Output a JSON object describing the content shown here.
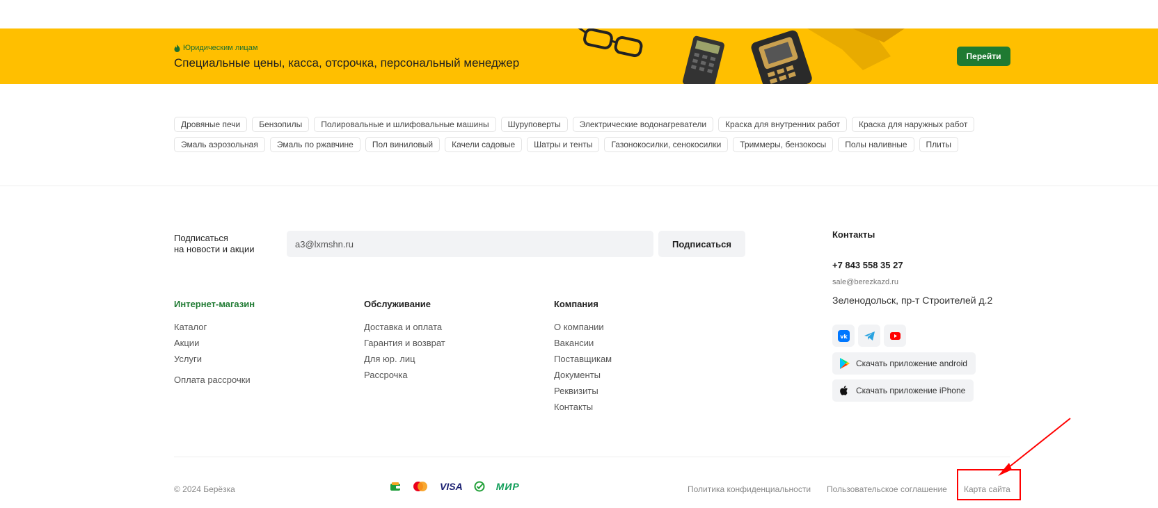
{
  "banner": {
    "kicker": "Юридическим лицам",
    "title": "Специальные цены, касса, отсрочка, персональный менеджер",
    "button": "Перейти"
  },
  "tags": {
    "row1": [
      "Дровяные печи",
      "Бензопилы",
      "Полировальные и шлифовальные машины",
      "Шуруповерты",
      "Электрические водонагреватели",
      "Краска для внутренних работ",
      "Краска для наружных работ"
    ],
    "row2": [
      "Эмаль аэрозольная",
      "Эмаль по ржавчине",
      "Пол виниловый",
      "Качели садовые",
      "Шатры и тенты",
      "Газонокосилки, сенокосилки",
      "Триммеры, бензокосы",
      "Полы наливные",
      "Плиты"
    ]
  },
  "subscribe": {
    "label_line1": "Подписаться",
    "label_line2": "на новости и акции",
    "input_value": "a3@lxmshn.ru",
    "button": "Подписаться"
  },
  "columns": {
    "shop": {
      "title": "Интернет-магазин",
      "links": [
        "Каталог",
        "Акции",
        "Услуги",
        "Оплата рассрочки"
      ]
    },
    "service": {
      "title": "Обслуживание",
      "links": [
        "Доставка и оплата",
        "Гарантия и возврат",
        "Для юр. лиц",
        "Рассрочка"
      ]
    },
    "company": {
      "title": "Компания",
      "links": [
        "О компании",
        "Вакансии",
        "Поставщикам",
        "Документы",
        "Реквизиты",
        "Контакты"
      ]
    }
  },
  "contacts": {
    "title": "Контакты",
    "phone": "+7 843 558 35 27",
    "email": "sale@berezkazd.ru",
    "address": "Зеленодольск, пр-т Строителей д.2",
    "socials": [
      "vk-icon",
      "telegram-icon",
      "youtube-icon"
    ],
    "android": "Скачать приложение android",
    "iphone": "Скачать приложение iPhone"
  },
  "bottom": {
    "copyright": "© 2024 Берёзка",
    "payments": [
      "wallet-icon",
      "mastercard-icon",
      "visa-icon",
      "sber-icon",
      "mir-icon"
    ],
    "visa_text": "VISA",
    "mir_text": "МИР",
    "privacy": "Политика конфиденциальности",
    "agreement": "Пользовательское соглашение",
    "sitemap": "Карта сайта"
  },
  "colors": {
    "banner_bg": "#ffbf00",
    "accent_green": "#1f7a32",
    "annotation_red": "#ff0000"
  }
}
